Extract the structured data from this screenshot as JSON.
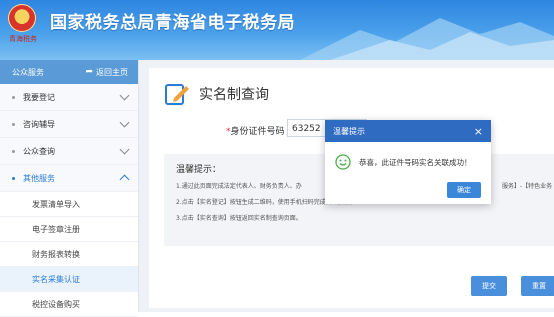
{
  "header": {
    "title": "国家税务总局青海省电子税务局",
    "emblem_text": "青海税务"
  },
  "sidebar": {
    "section_title": "公众服务",
    "back_label": "返回主页",
    "items": [
      {
        "label": "我要登记"
      },
      {
        "label": "咨询辅导"
      },
      {
        "label": "公众查询"
      },
      {
        "label": "其他服务"
      }
    ],
    "sub_items": [
      {
        "label": "发票清单导入"
      },
      {
        "label": "电子签章注册"
      },
      {
        "label": "财务报表转换"
      },
      {
        "label": "实名采集认证"
      },
      {
        "label": "税控设备购买"
      }
    ]
  },
  "main": {
    "page_title": "实名制查询",
    "id_label": "身份证件号码",
    "id_value": "63252",
    "notice": {
      "title": "温馨提示：",
      "lines": [
        "1.通过此页面完成法定代表人、财务负责人、办",
        "2.点击【实名登记】按钮生成二维码，使用手机扫码完成后继操作。",
        "3.点击【实名查询】按钮返回实名制查询页面。"
      ],
      "right_fragment": "服务】-【特色业务"
    },
    "submit_label": "提交",
    "reset_label": "重置"
  },
  "dialog": {
    "title": "温馨提示",
    "message": "恭喜，此证件号码实名关联成功！",
    "ok_label": "确定"
  },
  "colors": {
    "header_blue": "#2f86e0",
    "sidebar_head": "#5a9ad6",
    "dialog_head": "#2f6bc0",
    "accent": "#2a7bd1"
  }
}
